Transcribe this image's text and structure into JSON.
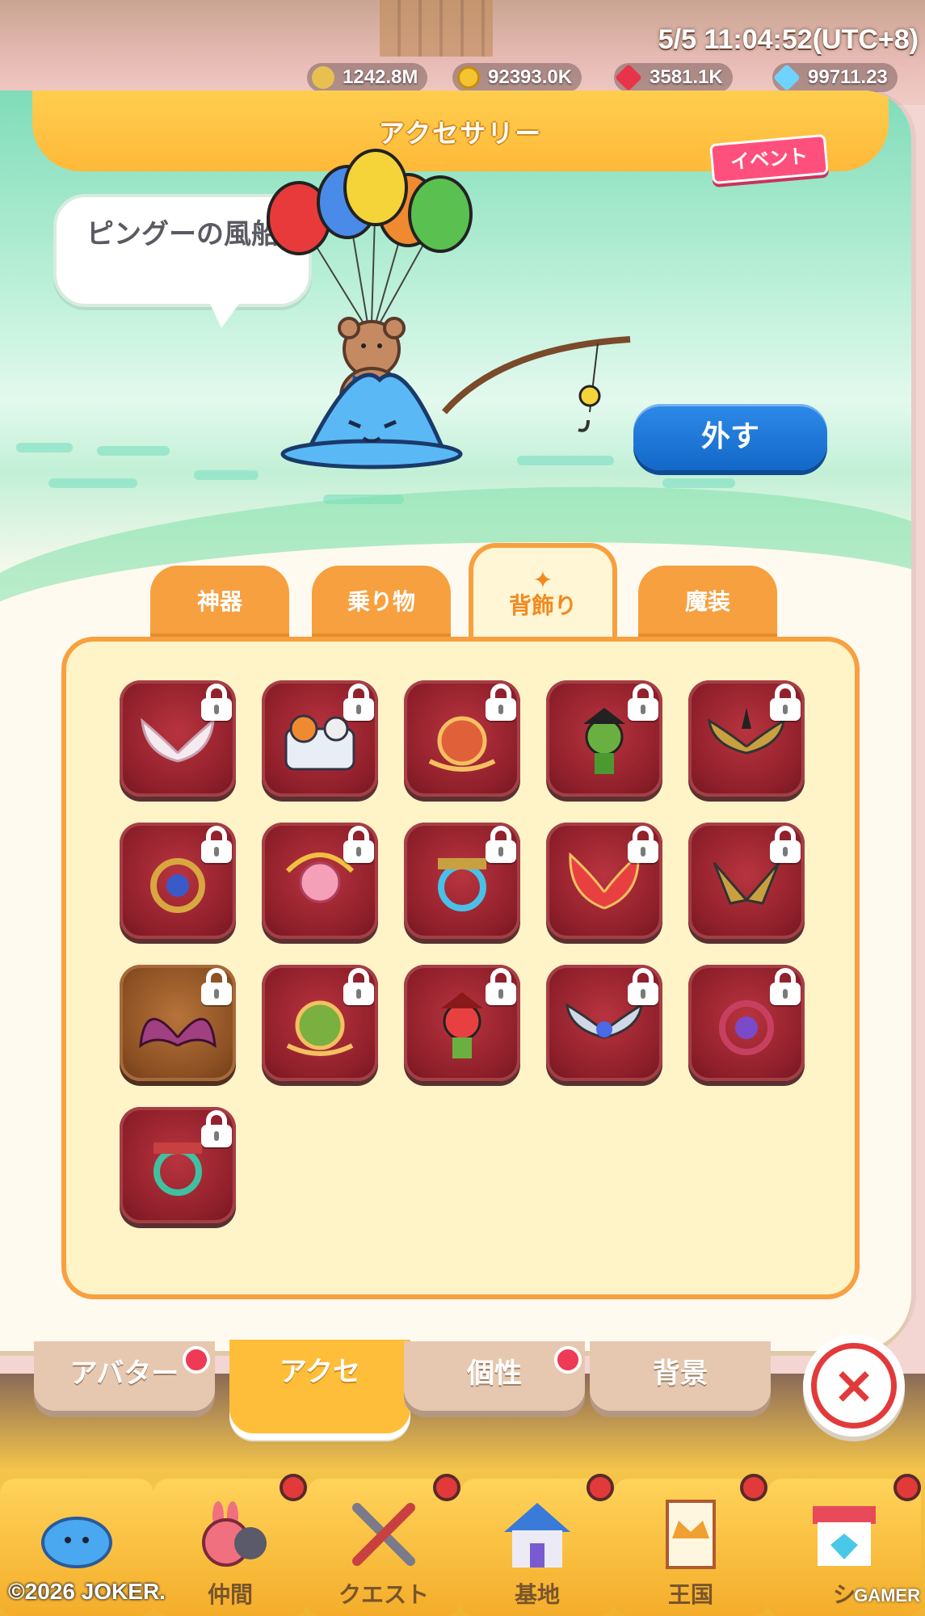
{
  "status": {
    "datetime": "5/5 11:04:52(UTC+8)",
    "currencies": [
      {
        "icon": "sword-power-icon",
        "value": "1242.8M"
      },
      {
        "icon": "gold-coin-icon",
        "value": "92393.0K"
      },
      {
        "icon": "red-gem-icon",
        "value": "3581.1K"
      },
      {
        "icon": "diamond-icon",
        "value": "99711.23"
      }
    ]
  },
  "header": {
    "title": "アクセサリー",
    "event_badge": "イベント"
  },
  "preview": {
    "item_name": "ピングーの風船",
    "unequip_label": "外す"
  },
  "categories": [
    {
      "label": "神器",
      "active": false
    },
    {
      "label": "乗り物",
      "active": false
    },
    {
      "label": "背飾り",
      "active": true,
      "icon": "wing-icon"
    },
    {
      "label": "魔装",
      "active": false
    }
  ],
  "items": [
    {
      "name": "white-angel-wings",
      "locked": true
    },
    {
      "name": "cats-wagon",
      "locked": true
    },
    {
      "name": "red-flame-crest",
      "locked": true
    },
    {
      "name": "pirate-captain-ghost",
      "locked": true
    },
    {
      "name": "dark-gold-wings",
      "locked": true
    },
    {
      "name": "gold-clockwork-halo",
      "locked": true
    },
    {
      "name": "cupid-cherub",
      "locked": true
    },
    {
      "name": "blue-mech-ring",
      "locked": true
    },
    {
      "name": "red-phoenix-wings",
      "locked": true
    },
    {
      "name": "gold-dragon-wings",
      "locked": true
    },
    {
      "name": "bat-wings",
      "locked": true
    },
    {
      "name": "gold-flame-crest",
      "locked": true
    },
    {
      "name": "red-pirate-ghost",
      "locked": true
    },
    {
      "name": "silver-blue-wings",
      "locked": true
    },
    {
      "name": "red-clockwork-halo",
      "locked": true
    },
    {
      "name": "green-mech-ring",
      "locked": true
    }
  ],
  "bottom_tabs": [
    {
      "label": "アバター",
      "badge": true,
      "active": false
    },
    {
      "label": "アクセ",
      "badge": false,
      "active": true
    },
    {
      "label": "個性",
      "badge": true,
      "active": false
    },
    {
      "label": "背景",
      "badge": false,
      "active": false
    }
  ],
  "close_label": "×",
  "nav": [
    {
      "label": "",
      "icon": "slime-icon"
    },
    {
      "label": "仲間",
      "icon": "friends-icon"
    },
    {
      "label": "クエスト",
      "icon": "crossed-swords-icon"
    },
    {
      "label": "基地",
      "icon": "house-icon"
    },
    {
      "label": "王国",
      "icon": "crown-banner-icon"
    },
    {
      "label": "シ",
      "icon": "shop-icon"
    }
  ],
  "copyright": "©2026 JOKER.",
  "watermark": "GAMER",
  "colors": {
    "accent": "#f7a040",
    "banner": "#ffbe3a",
    "item_bg": "#8e1f2a",
    "unequip": "#1368c8",
    "close": "#e23a3a"
  }
}
